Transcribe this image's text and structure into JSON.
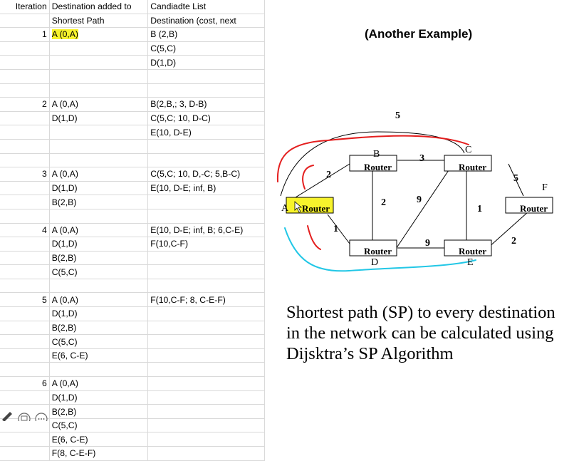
{
  "table": {
    "rows": [
      [
        "Iteration",
        "Destination added to",
        "Candiadte List"
      ],
      [
        "",
        "Shortest Path",
        "Destination (cost, next"
      ],
      [
        "1",
        "A (0,A)",
        "B (2,B)"
      ],
      [
        "",
        "",
        "C(5,C)"
      ],
      [
        "",
        "",
        "D(1,D)"
      ],
      [
        "",
        "",
        ""
      ],
      [
        "",
        "",
        ""
      ],
      [
        "2",
        "A (0,A)",
        "B(2,B,; 3, D-B)"
      ],
      [
        "",
        "D(1,D)",
        "C(5,C;  10, D-C)"
      ],
      [
        "",
        "",
        "E(10, D-E)"
      ],
      [
        "",
        "",
        ""
      ],
      [
        "",
        "",
        ""
      ],
      [
        "3",
        "A (0,A)",
        "C(5,C;  10, D,-C; 5,B-C)"
      ],
      [
        "",
        "D(1,D)",
        "E(10, D-E;  inf, B)"
      ],
      [
        "",
        "B(2,B)",
        ""
      ],
      [
        "",
        "",
        ""
      ],
      [
        "4",
        "A (0,A)",
        "E(10, D-E;  inf, B; 6,C-E)"
      ],
      [
        "",
        "D(1,D)",
        "F(10,C-F)"
      ],
      [
        "",
        "B(2,B)",
        ""
      ],
      [
        "",
        "C(5,C)",
        ""
      ],
      [
        "",
        "",
        ""
      ],
      [
        "5",
        "A (0,A)",
        "F(10,C-F;  8, C-E-F)"
      ],
      [
        "",
        "D(1,D)",
        ""
      ],
      [
        "",
        "B(2,B)",
        ""
      ],
      [
        "",
        "C(5,C)",
        ""
      ],
      [
        "",
        "E(6, C-E)",
        ""
      ],
      [
        "",
        "",
        ""
      ],
      [
        "6",
        "A (0,A)",
        ""
      ],
      [
        "",
        "D(1,D)",
        ""
      ],
      [
        "",
        "B(2,B)",
        ""
      ],
      [
        "",
        "C(5,C)",
        ""
      ],
      [
        "",
        "E(6, C-E)",
        ""
      ],
      [
        "",
        "F(8, C-E-F)",
        ""
      ]
    ],
    "highlight_cell": {
      "row": 2,
      "col": 1
    }
  },
  "title": "(Another Example)",
  "diagram": {
    "router_label": "Router",
    "nodes": [
      "A",
      "B",
      "C",
      "D",
      "E",
      "F"
    ],
    "weights": {
      "top_arc": "5",
      "ab": "2",
      "bc": "3",
      "cf": "5",
      "bd": "2",
      "dc": "9",
      "ad": "1",
      "de": "9",
      "ce": "1",
      "ef": "2"
    }
  },
  "caption": "Shortest path (SP) to every destination in the network can be calculated using Dijsktra’s SP Algorithm",
  "colors": {
    "highlight": "#f7f32c",
    "annotation_red": "#e41e1e",
    "annotation_cyan": "#22c7e6",
    "grid": "#d9d9d9"
  },
  "toolbar": {
    "icons": [
      "pen-icon",
      "comment-icon",
      "more-icon"
    ]
  }
}
